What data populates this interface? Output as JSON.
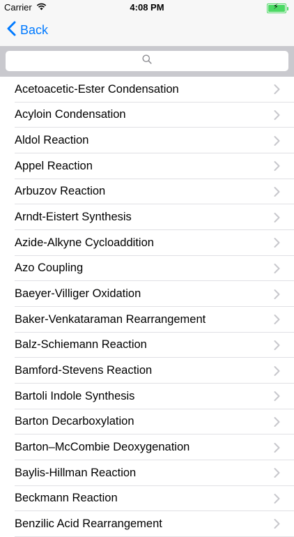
{
  "status_bar": {
    "carrier": "Carrier",
    "time": "4:08 PM",
    "battery_level": 1.0,
    "battery_color": "#4cd964"
  },
  "nav": {
    "back_label": "Back",
    "back_icon": "chevron-left-icon",
    "accent_color": "#007aff"
  },
  "search": {
    "placeholder": "",
    "icon": "search-icon"
  },
  "list": {
    "items": [
      {
        "label": "Acetoacetic-Ester Condensation"
      },
      {
        "label": "Acyloin Condensation"
      },
      {
        "label": "Aldol Reaction"
      },
      {
        "label": "Appel Reaction"
      },
      {
        "label": "Arbuzov Reaction"
      },
      {
        "label": "Arndt-Eistert Synthesis"
      },
      {
        "label": "Azide-Alkyne Cycloaddition"
      },
      {
        "label": "Azo Coupling"
      },
      {
        "label": "Baeyer-Villiger Oxidation"
      },
      {
        "label": "Baker-Venkataraman Rearrangement"
      },
      {
        "label": "Balz-Schiemann Reaction"
      },
      {
        "label": "Bamford-Stevens Reaction"
      },
      {
        "label": "Bartoli Indole Synthesis"
      },
      {
        "label": "Barton Decarboxylation"
      },
      {
        "label": "Barton–McCombie Deoxygenation"
      },
      {
        "label": "Baylis-Hillman Reaction"
      },
      {
        "label": "Beckmann Reaction"
      },
      {
        "label": "Benzilic Acid Rearrangement"
      }
    ]
  }
}
